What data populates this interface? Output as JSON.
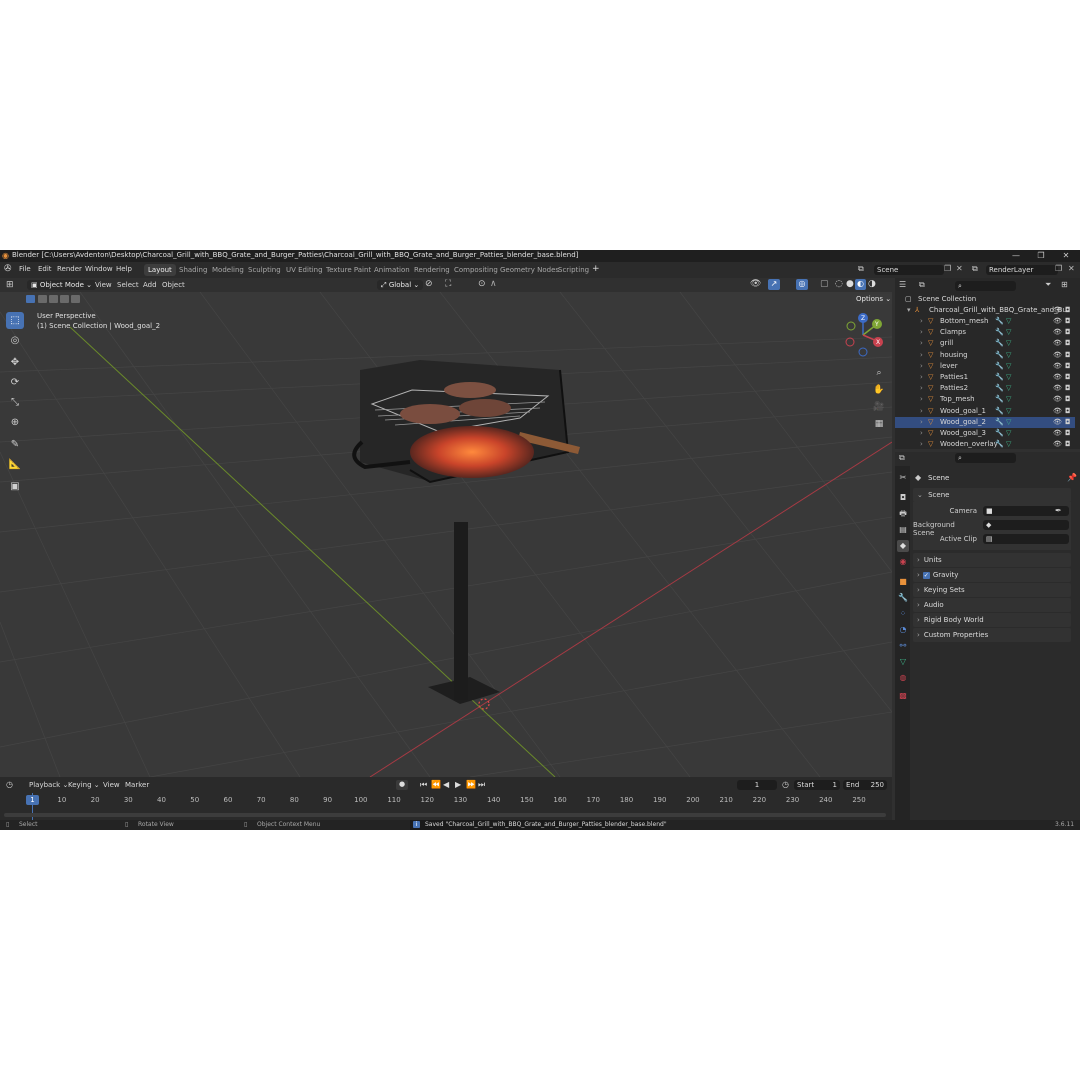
{
  "window": {
    "title": "Blender [C:\\Users\\Avdenton\\Desktop\\Charcoal_Grill_with_BBQ_Grate_and_Burger_Patties\\Charcoal_Grill_with_BBQ_Grate_and_Burger_Patties_blender_base.blend]",
    "controls": [
      "—",
      "❐",
      "✕"
    ]
  },
  "menu": {
    "items": [
      "File",
      "Edit",
      "Render",
      "Window",
      "Help"
    ],
    "workspaces": [
      "Layout",
      "Shading",
      "Modeling",
      "Sculpting",
      "UV Editing",
      "Texture Paint",
      "Animation",
      "Rendering",
      "Compositing",
      "Geometry Nodes",
      "Scripting"
    ],
    "active_workspace": "Layout",
    "add_tab": "+",
    "scene": "Scene",
    "view_layer": "RenderLayer"
  },
  "viewport_header": {
    "mode": "Object Mode",
    "menus": [
      "View",
      "Select",
      "Add",
      "Object"
    ],
    "orientation": "Global",
    "options": "Options"
  },
  "viewport": {
    "perspective": "User Perspective",
    "collection_info": "(1) Scene Collection | Wood_goal_2",
    "gizmo": {
      "z": "Z",
      "y": "Y",
      "x": "X"
    }
  },
  "outliner": {
    "root": "Scene Collection",
    "collection": "Charcoal_Grill_with_BBQ_Grate_and_Bu",
    "objects": [
      "Bottom_mesh",
      "Clamps",
      "grill",
      "housing",
      "lever",
      "Patties1",
      "Patties2",
      "Top_mesh",
      "Wood_goal_1",
      "Wood_goal_2",
      "Wood_goal_3",
      "Wooden_overlay"
    ],
    "selected": "Wood_goal_2"
  },
  "properties": {
    "header": "Scene",
    "panel": "Scene",
    "fields": [
      {
        "label": "Camera",
        "value": ""
      },
      {
        "label": "Background Scene",
        "value": ""
      },
      {
        "label": "Active Clip",
        "value": ""
      }
    ],
    "sections": [
      "Units",
      "Gravity",
      "Keying Sets",
      "Audio",
      "Rigid Body World",
      "Custom Properties"
    ],
    "gravity_checked": true
  },
  "timeline": {
    "menus": [
      "Playback",
      "Keying",
      "View",
      "Marker"
    ],
    "current_frame": "1",
    "start_label": "Start",
    "start": "1",
    "end_label": "End",
    "end": "250",
    "ticks": [
      "1",
      "10",
      "20",
      "30",
      "40",
      "50",
      "60",
      "70",
      "80",
      "90",
      "100",
      "110",
      "120",
      "130",
      "140",
      "150",
      "160",
      "170",
      "180",
      "190",
      "200",
      "210",
      "220",
      "230",
      "240",
      "250"
    ]
  },
  "status": {
    "select": "Select",
    "rotate": "Rotate View",
    "context": "Object Context Menu",
    "message": "Saved \"Charcoal_Grill_with_BBQ_Grate_and_Burger_Patties_blender_base.blend\"",
    "version": "3.6.11"
  },
  "colors": {
    "accent": "#4772b3",
    "object_icon": "#e8913b",
    "mesh_data": "#3fb58a",
    "x_axis": "#c8424f",
    "y_axis": "#7fa735",
    "z_axis": "#3c6bc6"
  }
}
